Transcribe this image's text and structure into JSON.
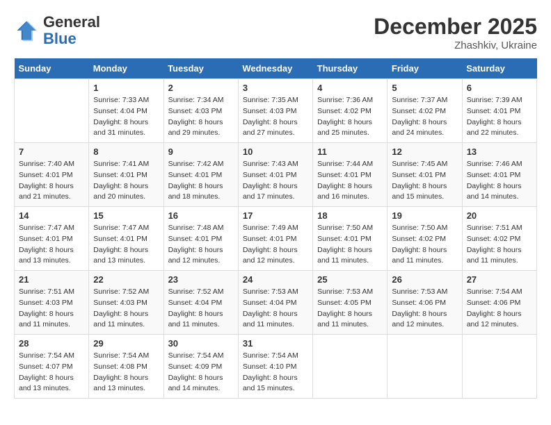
{
  "logo": {
    "general": "General",
    "blue": "Blue"
  },
  "header": {
    "month": "December 2025",
    "location": "Zhashkiv, Ukraine"
  },
  "weekdays": [
    "Sunday",
    "Monday",
    "Tuesday",
    "Wednesday",
    "Thursday",
    "Friday",
    "Saturday"
  ],
  "weeks": [
    [
      null,
      {
        "day": 1,
        "sunrise": "7:33 AM",
        "sunset": "4:04 PM",
        "daylight": "8 hours and 31 minutes."
      },
      {
        "day": 2,
        "sunrise": "7:34 AM",
        "sunset": "4:03 PM",
        "daylight": "8 hours and 29 minutes."
      },
      {
        "day": 3,
        "sunrise": "7:35 AM",
        "sunset": "4:03 PM",
        "daylight": "8 hours and 27 minutes."
      },
      {
        "day": 4,
        "sunrise": "7:36 AM",
        "sunset": "4:02 PM",
        "daylight": "8 hours and 25 minutes."
      },
      {
        "day": 5,
        "sunrise": "7:37 AM",
        "sunset": "4:02 PM",
        "daylight": "8 hours and 24 minutes."
      },
      {
        "day": 6,
        "sunrise": "7:39 AM",
        "sunset": "4:01 PM",
        "daylight": "8 hours and 22 minutes."
      }
    ],
    [
      {
        "day": 7,
        "sunrise": "7:40 AM",
        "sunset": "4:01 PM",
        "daylight": "8 hours and 21 minutes."
      },
      {
        "day": 8,
        "sunrise": "7:41 AM",
        "sunset": "4:01 PM",
        "daylight": "8 hours and 20 minutes."
      },
      {
        "day": 9,
        "sunrise": "7:42 AM",
        "sunset": "4:01 PM",
        "daylight": "8 hours and 18 minutes."
      },
      {
        "day": 10,
        "sunrise": "7:43 AM",
        "sunset": "4:01 PM",
        "daylight": "8 hours and 17 minutes."
      },
      {
        "day": 11,
        "sunrise": "7:44 AM",
        "sunset": "4:01 PM",
        "daylight": "8 hours and 16 minutes."
      },
      {
        "day": 12,
        "sunrise": "7:45 AM",
        "sunset": "4:01 PM",
        "daylight": "8 hours and 15 minutes."
      },
      {
        "day": 13,
        "sunrise": "7:46 AM",
        "sunset": "4:01 PM",
        "daylight": "8 hours and 14 minutes."
      }
    ],
    [
      {
        "day": 14,
        "sunrise": "7:47 AM",
        "sunset": "4:01 PM",
        "daylight": "8 hours and 13 minutes."
      },
      {
        "day": 15,
        "sunrise": "7:47 AM",
        "sunset": "4:01 PM",
        "daylight": "8 hours and 13 minutes."
      },
      {
        "day": 16,
        "sunrise": "7:48 AM",
        "sunset": "4:01 PM",
        "daylight": "8 hours and 12 minutes."
      },
      {
        "day": 17,
        "sunrise": "7:49 AM",
        "sunset": "4:01 PM",
        "daylight": "8 hours and 12 minutes."
      },
      {
        "day": 18,
        "sunrise": "7:50 AM",
        "sunset": "4:01 PM",
        "daylight": "8 hours and 11 minutes."
      },
      {
        "day": 19,
        "sunrise": "7:50 AM",
        "sunset": "4:02 PM",
        "daylight": "8 hours and 11 minutes."
      },
      {
        "day": 20,
        "sunrise": "7:51 AM",
        "sunset": "4:02 PM",
        "daylight": "8 hours and 11 minutes."
      }
    ],
    [
      {
        "day": 21,
        "sunrise": "7:51 AM",
        "sunset": "4:03 PM",
        "daylight": "8 hours and 11 minutes."
      },
      {
        "day": 22,
        "sunrise": "7:52 AM",
        "sunset": "4:03 PM",
        "daylight": "8 hours and 11 minutes."
      },
      {
        "day": 23,
        "sunrise": "7:52 AM",
        "sunset": "4:04 PM",
        "daylight": "8 hours and 11 minutes."
      },
      {
        "day": 24,
        "sunrise": "7:53 AM",
        "sunset": "4:04 PM",
        "daylight": "8 hours and 11 minutes."
      },
      {
        "day": 25,
        "sunrise": "7:53 AM",
        "sunset": "4:05 PM",
        "daylight": "8 hours and 11 minutes."
      },
      {
        "day": 26,
        "sunrise": "7:53 AM",
        "sunset": "4:06 PM",
        "daylight": "8 hours and 12 minutes."
      },
      {
        "day": 27,
        "sunrise": "7:54 AM",
        "sunset": "4:06 PM",
        "daylight": "8 hours and 12 minutes."
      }
    ],
    [
      {
        "day": 28,
        "sunrise": "7:54 AM",
        "sunset": "4:07 PM",
        "daylight": "8 hours and 13 minutes."
      },
      {
        "day": 29,
        "sunrise": "7:54 AM",
        "sunset": "4:08 PM",
        "daylight": "8 hours and 13 minutes."
      },
      {
        "day": 30,
        "sunrise": "7:54 AM",
        "sunset": "4:09 PM",
        "daylight": "8 hours and 14 minutes."
      },
      {
        "day": 31,
        "sunrise": "7:54 AM",
        "sunset": "4:10 PM",
        "daylight": "8 hours and 15 minutes."
      },
      null,
      null,
      null
    ]
  ]
}
